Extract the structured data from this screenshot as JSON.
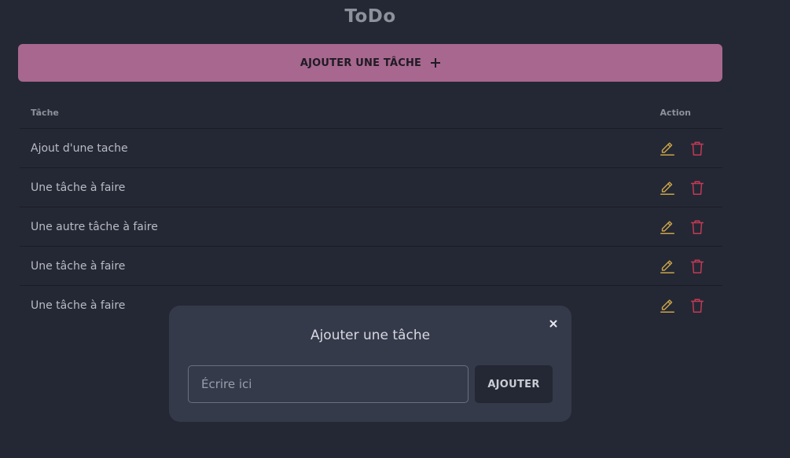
{
  "app": {
    "title": "ToDo"
  },
  "toolbar": {
    "add_label": "AJOUTER UNE TÂCHE"
  },
  "table": {
    "headers": {
      "task": "Tâche",
      "action": "Action"
    },
    "rows": [
      {
        "task": "Ajout d'une tache"
      },
      {
        "task": "Une tâche à faire"
      },
      {
        "task": "Une autre tâche à faire"
      },
      {
        "task": "Une tâche à faire"
      },
      {
        "task": "Une tâche à faire"
      }
    ]
  },
  "modal": {
    "title": "Ajouter une tâche",
    "input": {
      "value": "",
      "placeholder": "Écrire ici"
    },
    "submit_label": "AJOUTER"
  },
  "colors": {
    "background": "#242834",
    "accent": "#a7678f",
    "edit": "#c9a44a",
    "delete": "#c43a55",
    "modal": "#353a4b"
  },
  "icons": {
    "add": "plus-icon",
    "edit": "pencil-icon",
    "delete": "trash-icon",
    "close": "close-icon"
  }
}
